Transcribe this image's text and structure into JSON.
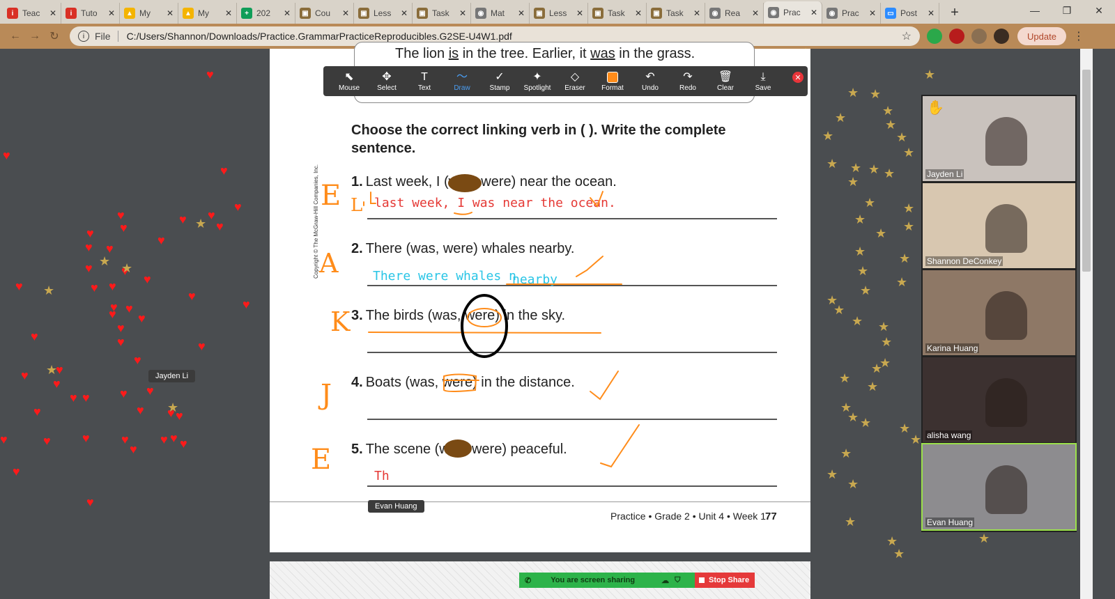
{
  "browser": {
    "tabs": [
      {
        "label": "Teac",
        "icon": "i",
        "icon_color": "#d93025"
      },
      {
        "label": "Tuto",
        "icon": "i",
        "icon_color": "#d93025"
      },
      {
        "label": "My",
        "icon": "▲",
        "icon_color": "#f4b400"
      },
      {
        "label": "My",
        "icon": "▲",
        "icon_color": "#f4b400"
      },
      {
        "label": "202",
        "icon": "+",
        "icon_color": "#0f9d58"
      },
      {
        "label": "Cou",
        "icon": "▣",
        "icon_color": "#8a6d3b"
      },
      {
        "label": "Less",
        "icon": "▣",
        "icon_color": "#8a6d3b"
      },
      {
        "label": "Task",
        "icon": "▣",
        "icon_color": "#8a6d3b"
      },
      {
        "label": "Mat",
        "icon": "◉",
        "icon_color": "#777777"
      },
      {
        "label": "Less",
        "icon": "▣",
        "icon_color": "#8a6d3b"
      },
      {
        "label": "Task",
        "icon": "▣",
        "icon_color": "#8a6d3b"
      },
      {
        "label": "Task",
        "icon": "▣",
        "icon_color": "#8a6d3b"
      },
      {
        "label": "Rea",
        "icon": "◉",
        "icon_color": "#777777"
      },
      {
        "label": "Prac",
        "icon": "◉",
        "icon_color": "#777777"
      },
      {
        "label": "Prac",
        "icon": "◉",
        "icon_color": "#777777"
      },
      {
        "label": "Post",
        "icon": "▭",
        "icon_color": "#2d8cff"
      }
    ],
    "active_tab_index": 13,
    "tab_close_glyph": "✕",
    "new_tab_glyph": "+",
    "window_controls": [
      "—",
      "❐",
      "✕"
    ],
    "address_scheme": "File",
    "address_url": "C:/Users/Shannon/Downloads/Practice.GrammarPracticeReproducibles.G2SE-U4W1.pdf",
    "update_label": "Update"
  },
  "annotation_toolbar": {
    "tools": [
      {
        "label": "Mouse",
        "icon": "⬉"
      },
      {
        "label": "Select",
        "icon": "✥"
      },
      {
        "label": "Text",
        "icon": "T"
      },
      {
        "label": "Draw",
        "icon": "〜"
      },
      {
        "label": "Stamp",
        "icon": "✓"
      },
      {
        "label": "Spotlight",
        "icon": "✦"
      },
      {
        "label": "Eraser",
        "icon": "◇"
      },
      {
        "label": "Format",
        "icon": ""
      },
      {
        "label": "Undo",
        "icon": "↶"
      },
      {
        "label": "Redo",
        "icon": "↷"
      },
      {
        "label": "Clear",
        "icon": "🗑"
      },
      {
        "label": "Save",
        "icon": "⤓"
      }
    ],
    "selected_tool": "Draw",
    "format_color": "#ff8c1a",
    "close_glyph": "✕"
  },
  "document": {
    "previous_sentence": {
      "pre": "The lion ",
      "is": "is",
      "mid": " in the tree. Earlier, it ",
      "was": "was",
      "post": " in the grass."
    },
    "instructions": "Choose the correct linking verb in ( ). Write the complete sentence.",
    "questions": [
      {
        "num": "1.",
        "text": "Last week, I (was, were) near the ocean."
      },
      {
        "num": "2.",
        "text": "There (was, were) whales nearby."
      },
      {
        "num": "3.",
        "text": "The birds (was, were) in the sky."
      },
      {
        "num": "4.",
        "text": "Boats (was, were) in the distance."
      },
      {
        "num": "5.",
        "text": "The scene (was, were) peaceful."
      }
    ],
    "copyright": "Copyright © The McGraw-Hill Companies, Inc.",
    "footer": "Practice • Grade 2 • Unit 4 • Week 1",
    "page_number": "77"
  },
  "handwriting": {
    "answer1": "last week, I was near  the ocean.",
    "answer2a": "There were whales n",
    "answer2b": "nearby",
    "answer5": "Th",
    "margin_letters": [
      "E",
      "L",
      "A",
      "K",
      "J",
      "E"
    ]
  },
  "name_tags": {
    "cursor1": "Jayden Li",
    "cursor2": "Evan Huang"
  },
  "participants": [
    {
      "name": "Jayden Li",
      "bg": "#c9c2bd",
      "raised_hand": "✋"
    },
    {
      "name": "Shannon DeConkey",
      "bg": "#d8c7b0"
    },
    {
      "name": "Karina Huang",
      "bg": "#8e7866"
    },
    {
      "name": "alisha wang",
      "bg": "#3c3130"
    },
    {
      "name": "Evan Huang",
      "bg": "#8d8c8f"
    }
  ],
  "screen_share": {
    "status": "You are screen sharing",
    "stop_label": "Stop Share"
  },
  "colors": {
    "heart": "#ff1a1a",
    "star": "#c8a850",
    "ink_orange": "#ff8c1a",
    "ink_red": "#e53935",
    "ink_cyan": "#29c5e6",
    "oval_brown": "#7a4a13"
  },
  "decorations": {
    "heart_glyph": "♥",
    "star_glyph": "★"
  }
}
